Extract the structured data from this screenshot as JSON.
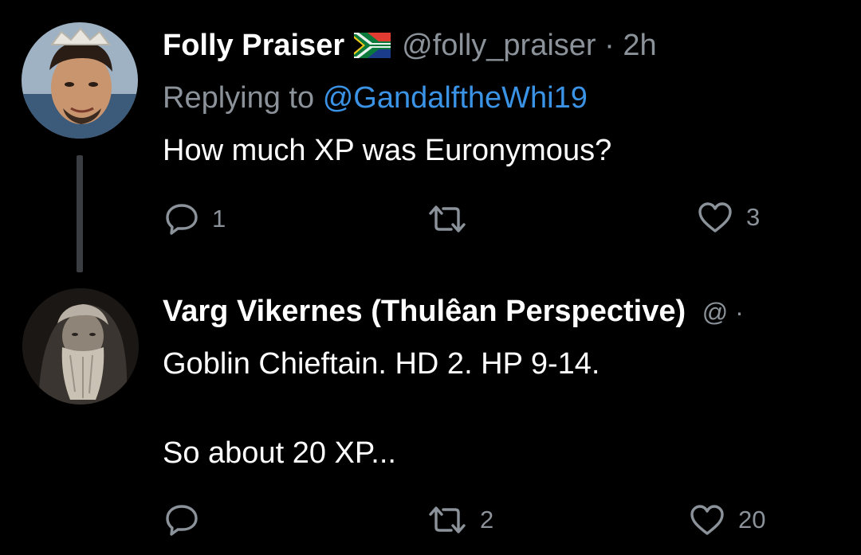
{
  "tweets": [
    {
      "display_name": "Folly Praiser",
      "flag_icon": "south-africa-flag-icon",
      "handle": "@folly_praiser",
      "separator": "·",
      "time": "2h",
      "reply_prefix": "Replying to",
      "reply_to": "@GandalftheWhi19",
      "text": "How much XP was Euronymous?",
      "reply_count": "1",
      "retweet_count": "",
      "like_count": "3"
    },
    {
      "display_name": "Varg Vikernes (Thulêan Perspective)",
      "handle_truncated": "@ ·",
      "text_line_1": "Goblin Chieftain. HD 2. HP 9-14.",
      "text_line_2": "So about 20 XP...",
      "reply_count": "",
      "retweet_count": "2",
      "like_count": "20"
    }
  ],
  "colors": {
    "background": "#000000",
    "primary_text": "#ffffff",
    "secondary_text": "#8b9299",
    "link": "#3b93e6",
    "thread_line": "#3a3d41"
  }
}
